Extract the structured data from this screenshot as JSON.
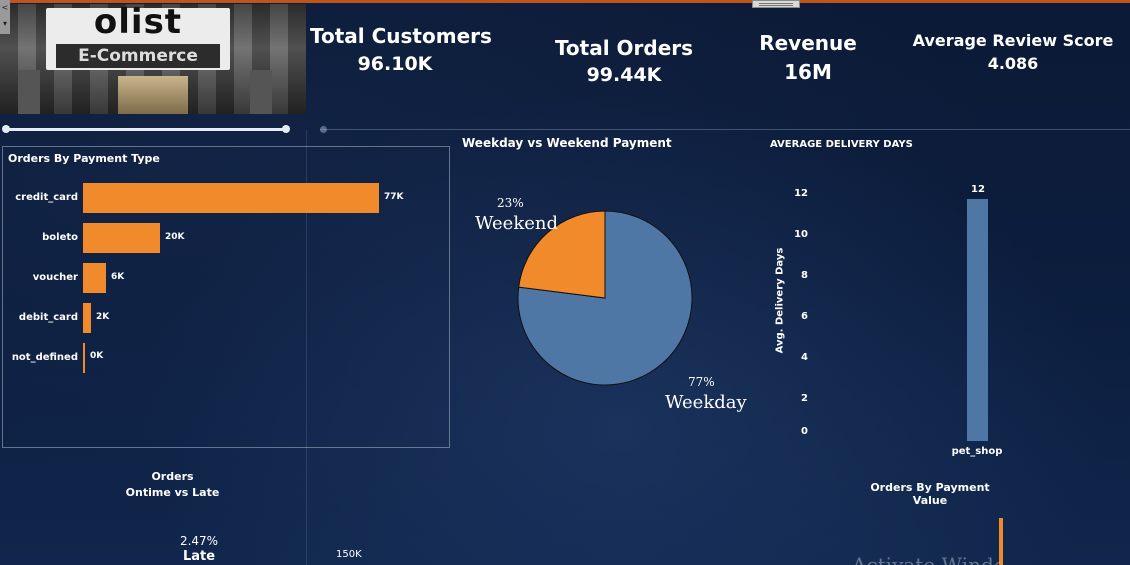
{
  "logo": {
    "brand": "olist",
    "subtitle": "E-Commerce"
  },
  "kpis": {
    "customers": {
      "label": "Total Customers",
      "value": "96.10K"
    },
    "orders": {
      "label": "Total Orders",
      "value": "99.44K"
    },
    "revenue": {
      "label": "Revenue",
      "value": "16M"
    },
    "review": {
      "label": "Average Review Score",
      "value": "4.086"
    }
  },
  "payment_type": {
    "title": "Orders By Payment Type",
    "rows": [
      {
        "label": "credit_card",
        "value_label": "77K"
      },
      {
        "label": "boleto",
        "value_label": "20K"
      },
      {
        "label": "voucher",
        "value_label": "6K"
      },
      {
        "label": "debit_card",
        "value_label": "2K"
      },
      {
        "label": "not_defined",
        "value_label": "0K"
      }
    ]
  },
  "weekday_pie": {
    "title": "Weekday vs Weekend Payment",
    "weekend_pct": "23%",
    "weekend_label": "Weekend",
    "weekday_pct": "77%",
    "weekday_label": "Weekday"
  },
  "delivery": {
    "title": "AVERAGE DELIVERY DAYS",
    "ylabel": "Avg. Delivery Days",
    "ticks": [
      "12",
      "10",
      "8",
      "6",
      "4",
      "2",
      "0"
    ],
    "bar_value": "12",
    "category": "pet_shop"
  },
  "ontime": {
    "title_line1": "Orders",
    "title_line2": "Ontime vs Late",
    "late_pct": "2.47%",
    "late_label": "Late",
    "axis_value": "150K"
  },
  "payment_value": {
    "title": "Orders By Payment Value"
  },
  "watermark": "Activate Windows",
  "colors": {
    "accent": "#f08a2a",
    "pie_blue": "#4e77a6",
    "bar_blue": "#4e77a6"
  },
  "chart_data": [
    {
      "type": "bar",
      "title": "Orders By Payment Type",
      "orientation": "horizontal",
      "categories": [
        "credit_card",
        "boleto",
        "voucher",
        "debit_card",
        "not_defined"
      ],
      "values": [
        77,
        20,
        6,
        2,
        0
      ],
      "units": "K"
    },
    {
      "type": "pie",
      "title": "Weekday vs Weekend Payment",
      "categories": [
        "Weekday",
        "Weekend"
      ],
      "values": [
        77,
        23
      ],
      "colors": [
        "#4e77a6",
        "#f08a2a"
      ]
    },
    {
      "type": "bar",
      "title": "AVERAGE DELIVERY DAYS",
      "ylabel": "Avg. Delivery Days",
      "categories": [
        "pet_shop"
      ],
      "values": [
        12
      ],
      "ylim": [
        0,
        12
      ]
    }
  ]
}
